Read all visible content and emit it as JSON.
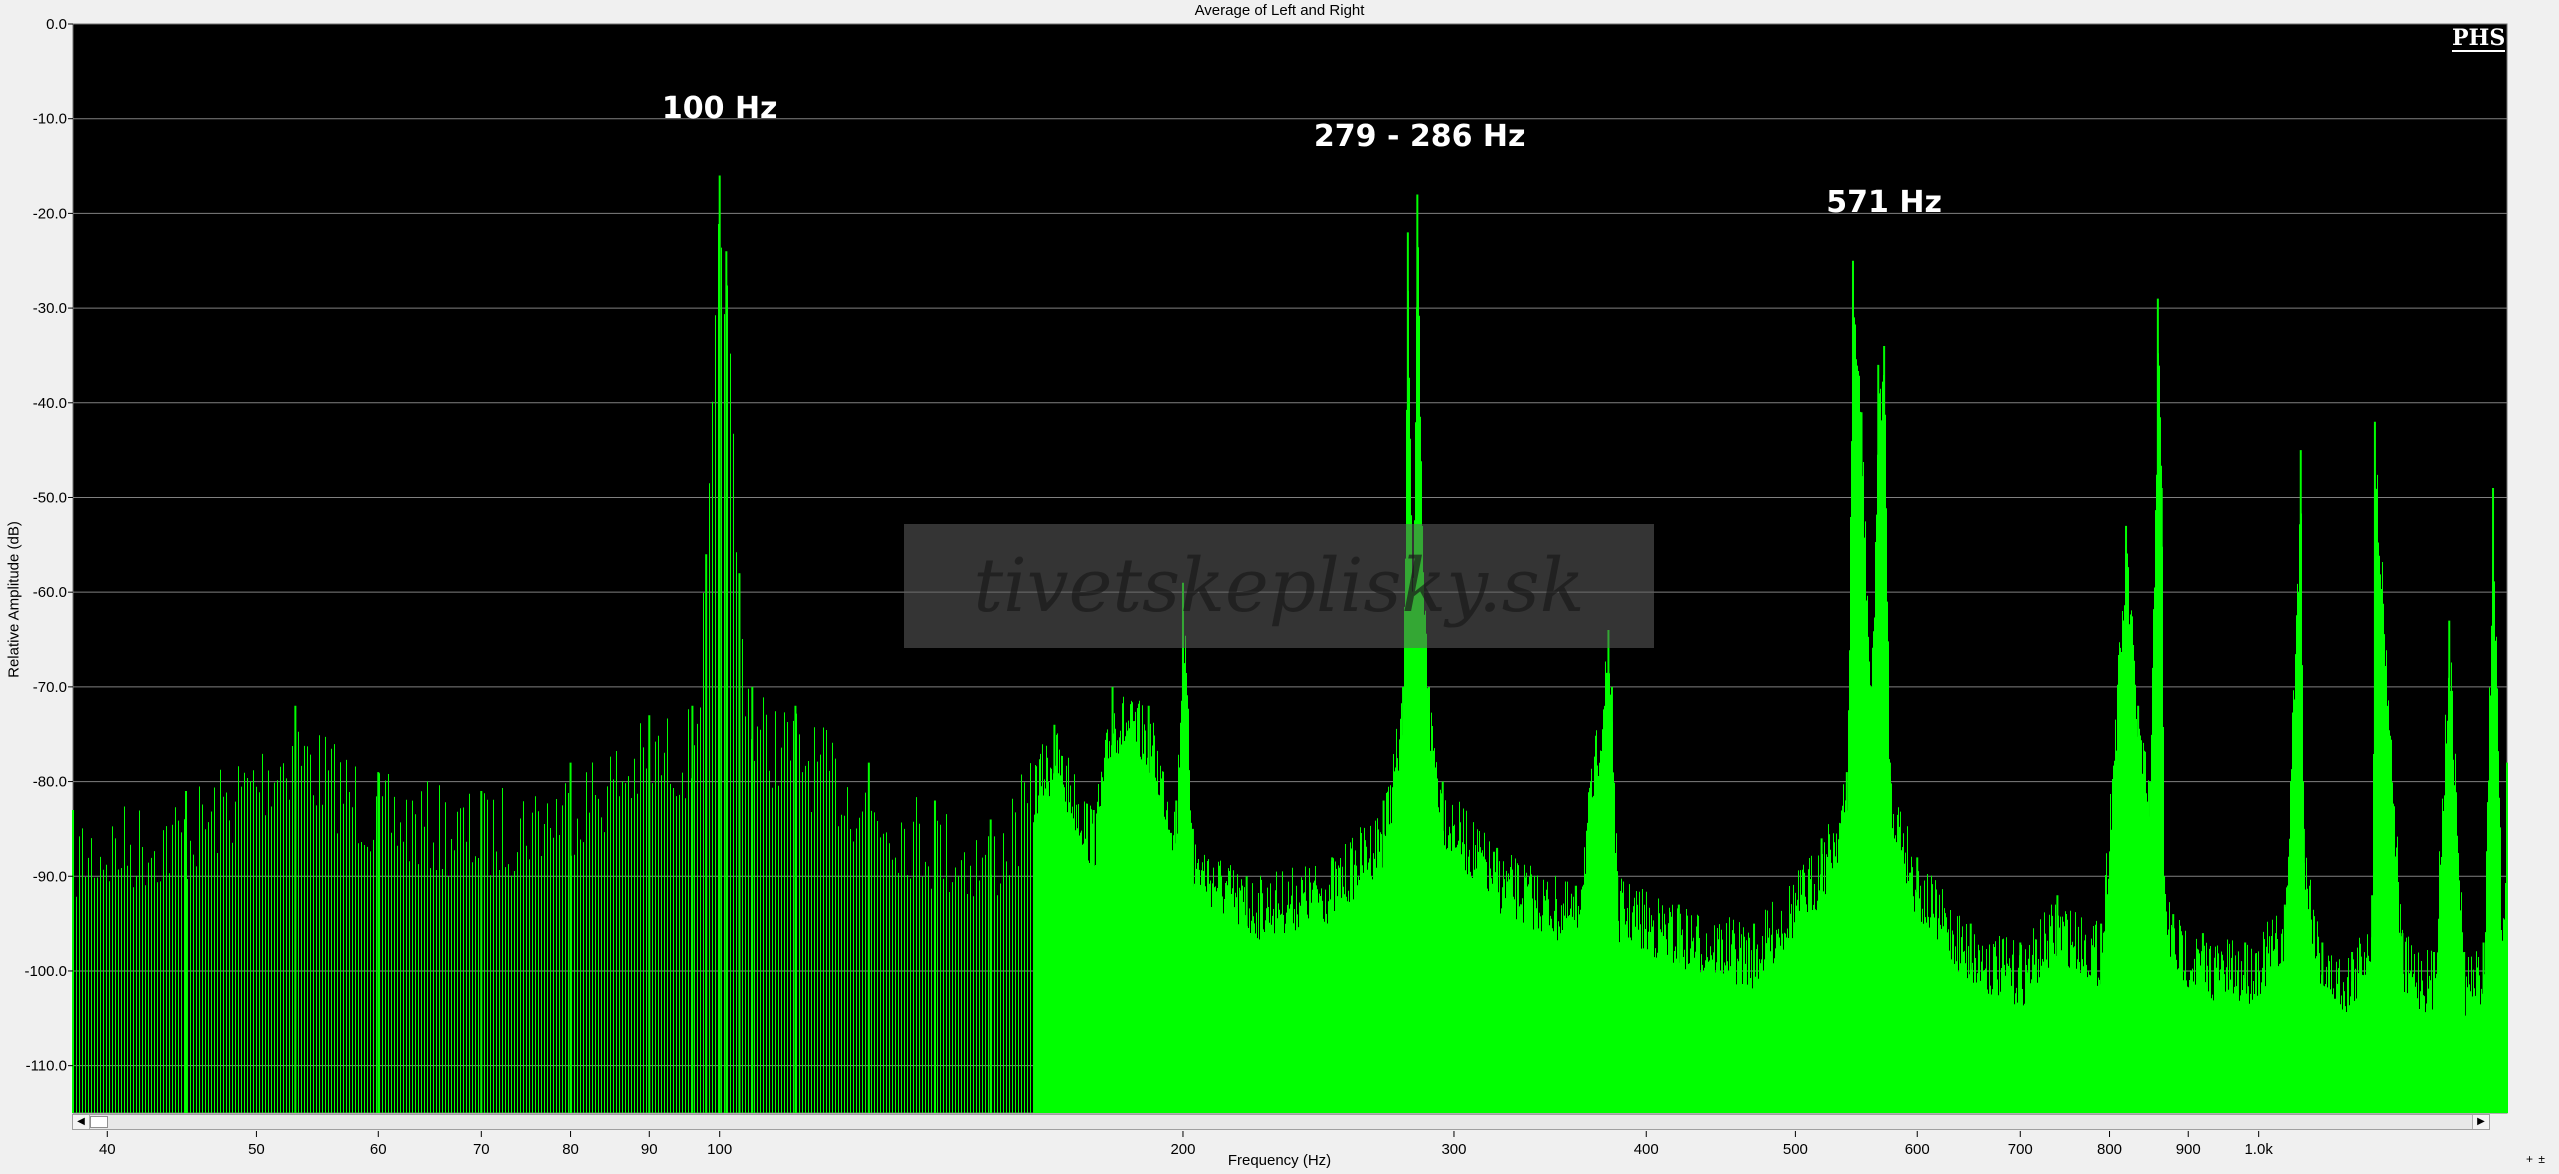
{
  "window": {
    "title": "Average of Left and Right",
    "logo_text": "PHS",
    "watermark_text": "tivetskeplisky.sk",
    "zoom_in_label": "+",
    "zoom_out_label": "±"
  },
  "scrollbar": {
    "left_arrow": "◀",
    "right_arrow": "▶"
  },
  "chart_data": {
    "type": "area",
    "title": "Average of Left and Right",
    "xlabel": "Frequency (Hz)",
    "ylabel": "Relative Amplitude (dB)",
    "xscale": "log",
    "xlim": [
      38,
      1450
    ],
    "ylim": [
      -115,
      0
    ],
    "grid": true,
    "y_ticks": [
      0,
      -10,
      -20,
      -30,
      -40,
      -50,
      -60,
      -70,
      -80,
      -90,
      -100,
      -110
    ],
    "y_tick_labels": [
      "0.0",
      "-10.0",
      "-20.0",
      "-30.0",
      "-40.0",
      "-50.0",
      "-60.0",
      "-70.0",
      "-80.0",
      "-90.0",
      "-100.0",
      "-110.0"
    ],
    "x_ticks": [
      40,
      50,
      60,
      70,
      80,
      90,
      100,
      200,
      300,
      400,
      500,
      600,
      700,
      800,
      900,
      1000
    ],
    "x_tick_labels": [
      "40",
      "50",
      "60",
      "70",
      "80",
      "90",
      "100",
      "200",
      "300",
      "400",
      "500",
      "600",
      "700",
      "800",
      "900",
      "1.0k"
    ],
    "colors": {
      "fill": "#00ff00",
      "plot_bg": "#000000",
      "grid": "#808080"
    },
    "series": [
      {
        "x": [
          38,
          45,
          53,
          60,
          70,
          80,
          90,
          96,
          98,
          100,
          101,
          103,
          105,
          112,
          125,
          138,
          150,
          165,
          175,
          180,
          190,
          198,
          200,
          203,
          220,
          250,
          270,
          278,
          280,
          282,
          284,
          286,
          289,
          295,
          320,
          360,
          378,
          380,
          383,
          420,
          470,
          520,
          540,
          545,
          552,
          560,
          566,
          571,
          576,
          600,
          650,
          700,
          740,
          790,
          820,
          835,
          850,
          860,
          865,
          868,
          880,
          920,
          980,
          1040,
          1065,
          1070,
          1100,
          1150,
          1185,
          1190,
          1240,
          1300,
          1330,
          1360,
          1400,
          1420,
          1440,
          1450
        ],
        "y": [
          -83,
          -81,
          -72,
          -79,
          -81,
          -78,
          -73,
          -72,
          -56,
          -16,
          -24,
          -58,
          -70,
          -72,
          -78,
          -82,
          -84,
          -74,
          -83,
          -70,
          -72,
          -82,
          -59,
          -85,
          -90,
          -88,
          -82,
          -70,
          -22,
          -60,
          -18,
          -53,
          -70,
          -80,
          -87,
          -91,
          -64,
          -70,
          -90,
          -93,
          -95,
          -86,
          -79,
          -25,
          -41,
          -70,
          -36,
          -34,
          -78,
          -88,
          -95,
          -97,
          -92,
          -95,
          -53,
          -72,
          -80,
          -29,
          -49,
          -90,
          -94,
          -96,
          -97,
          -93,
          -45,
          -85,
          -97,
          -98,
          -92,
          -42,
          -96,
          -98,
          -63,
          -98,
          -97,
          -49,
          -97,
          -78
        ]
      }
    ],
    "annotations": [
      {
        "text": "100 Hz",
        "x": 100,
        "y": -10
      },
      {
        "text": "279 - 286 Hz",
        "x": 285,
        "y": -13
      },
      {
        "text": "571 Hz",
        "x": 571,
        "y": -20
      }
    ]
  }
}
